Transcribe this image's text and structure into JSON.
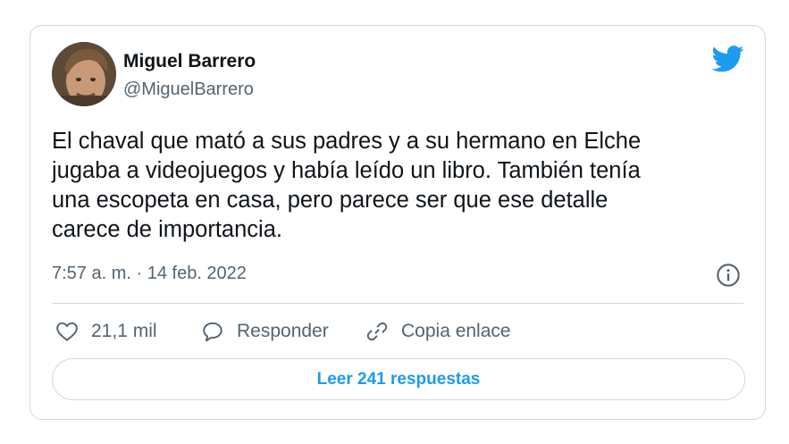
{
  "tweet": {
    "author": {
      "name": "Miguel Barrero",
      "handle": "@MiguelBarrero"
    },
    "text_lines": [
      "El chaval que mató a sus padres y a su hermano en Elche",
      "jugaba a videojuegos y había leído un libro. También tenía",
      "una escopeta en casa, pero parece ser que ese detalle",
      "carece de importancia."
    ],
    "timestamp": "7:57 a. m. · 14 feb. 2022"
  },
  "actions": {
    "like_count": "21,1 mil",
    "reply_label": "Responder",
    "copy_link_label": "Copia enlace"
  },
  "read_replies_label": "Leer 241 respuestas",
  "icons": {
    "brand": "twitter-bird-icon",
    "info": "info-icon",
    "like": "heart-icon",
    "reply": "speech-bubble-icon",
    "copy_link": "link-icon"
  },
  "colors": {
    "brand_blue": "#1d9bf0",
    "text_primary": "#0f1419",
    "text_secondary": "#536471",
    "border": "#cfd9de"
  }
}
